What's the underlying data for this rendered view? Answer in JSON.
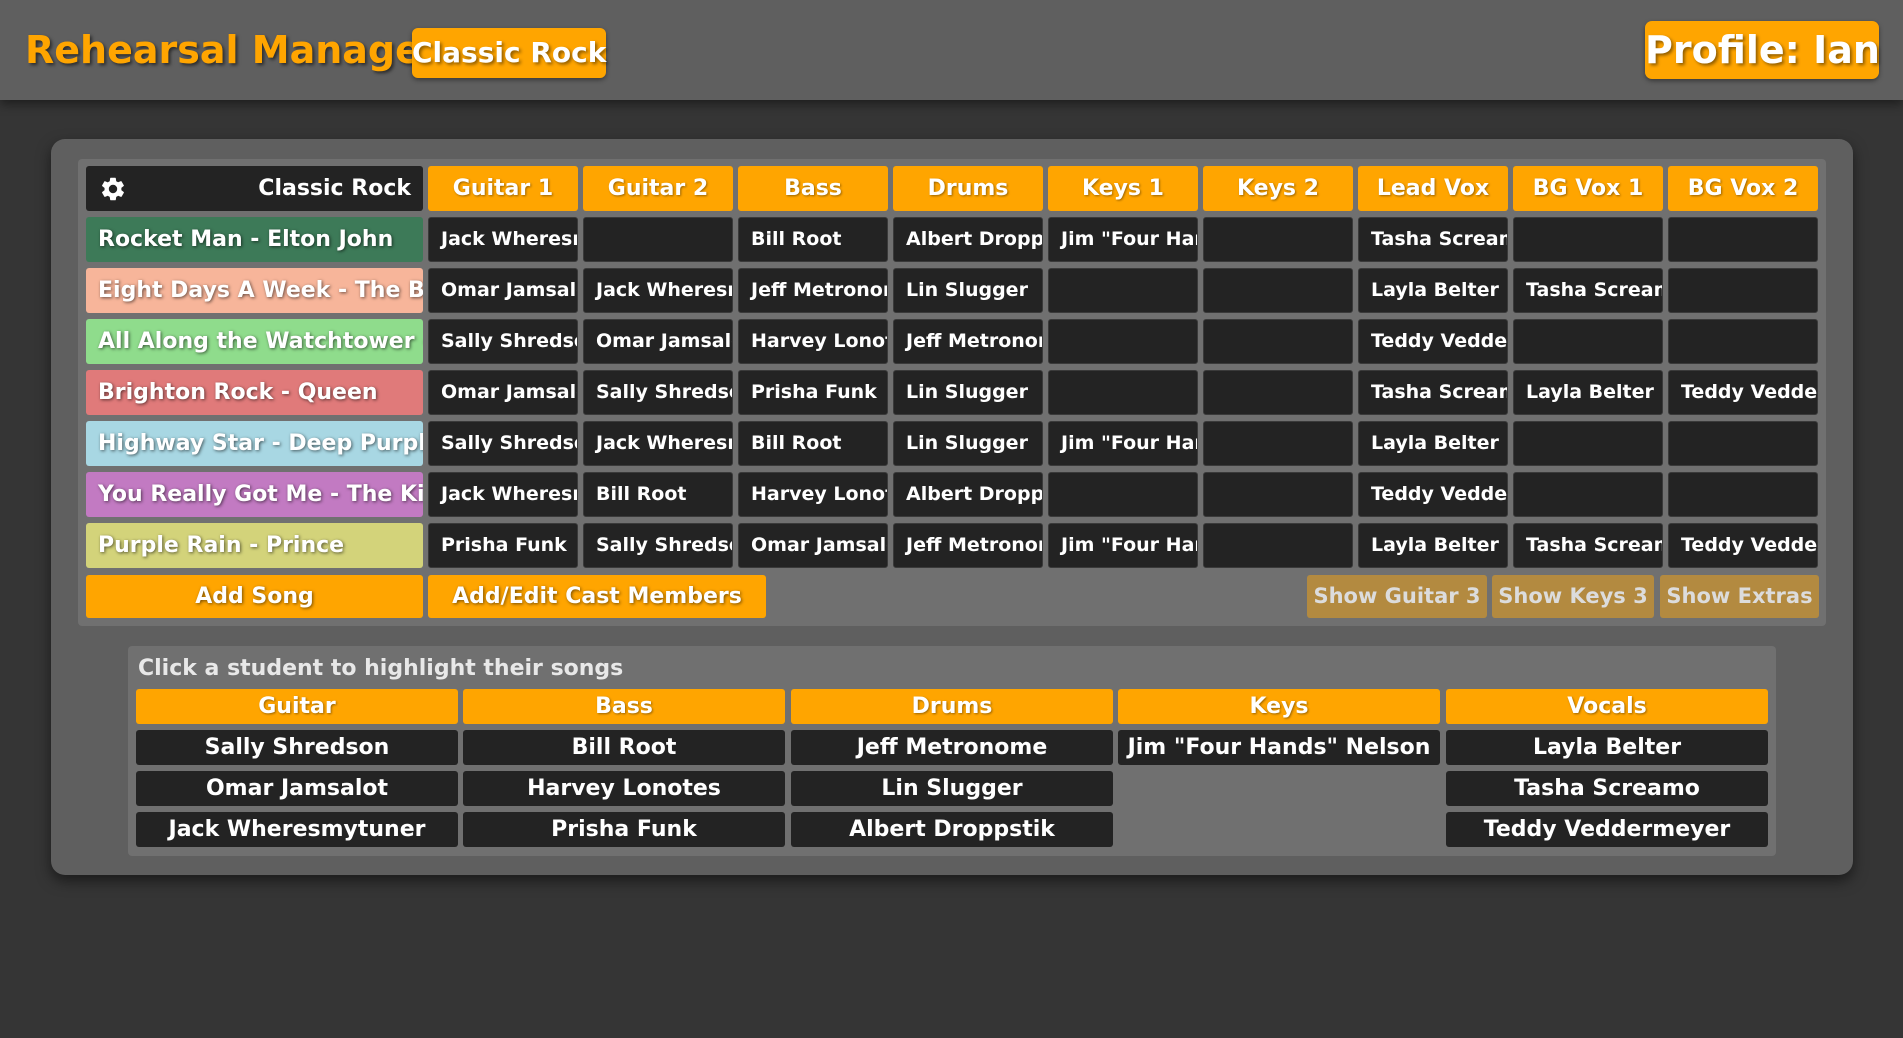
{
  "header": {
    "app_title": "Rehearsal Manager",
    "band_button": "Classic Rock",
    "profile_button": "Profile: Ian"
  },
  "grid": {
    "corner_label": "Classic Rock",
    "settings_icon": "gear-icon",
    "columns": [
      "Guitar 1",
      "Guitar 2",
      "Bass",
      "Drums",
      "Keys 1",
      "Keys 2",
      "Lead Vox",
      "BG Vox 1",
      "BG Vox 2"
    ],
    "songs": [
      {
        "title": "Rocket Man - Elton John",
        "color": "#3d7a58",
        "cast": [
          "Jack Wheresmytuner",
          "",
          "Bill Root",
          "Albert Droppstik",
          "Jim \"Four Hands\" Nelson",
          "",
          "Tasha Screamo",
          "",
          ""
        ]
      },
      {
        "title": "Eight Days A Week - The Beatles",
        "color": "#f7b59a",
        "cast": [
          "Omar Jamsalot",
          "Jack Wheresmytuner",
          "Jeff Metronome",
          "Lin Slugger",
          "",
          "",
          "Layla Belter",
          "Tasha Screamo",
          ""
        ]
      },
      {
        "title": "All Along the Watchtower - Jimi Hendrix",
        "color": "#8fdc8c",
        "cast": [
          "Sally Shredson",
          "Omar Jamsalot",
          "Harvey Lonotes",
          "Jeff Metronome",
          "",
          "",
          "Teddy Veddermeyer",
          "",
          ""
        ]
      },
      {
        "title": "Brighton Rock - Queen",
        "color": "#e07a7a",
        "cast": [
          "Omar Jamsalot",
          "Sally Shredson",
          "Prisha Funk",
          "Lin Slugger",
          "",
          "",
          "Tasha Screamo",
          "Layla Belter",
          "Teddy Veddermeyer"
        ]
      },
      {
        "title": "Highway Star - Deep Purple",
        "color": "#a8d7e3",
        "cast": [
          "Sally Shredson",
          "Jack Wheresmytuner",
          "Bill Root",
          "Lin Slugger",
          "Jim \"Four Hands\" Nelson",
          "",
          "Layla Belter",
          "",
          ""
        ]
      },
      {
        "title": "You Really Got Me - The Kinks",
        "color": "#c27ac2",
        "cast": [
          "Jack Wheresmytuner",
          "Bill Root",
          "Harvey Lonotes",
          "Albert Droppstik",
          "",
          "",
          "Teddy Veddermeyer",
          "",
          ""
        ]
      },
      {
        "title": "Purple Rain - Prince",
        "color": "#d3d37a",
        "cast": [
          "Prisha Funk",
          "Sally Shredson",
          "Omar Jamsalot",
          "Jeff Metronome",
          "Jim \"Four Hands\" Nelson",
          "",
          "Layla Belter",
          "Tasha Screamo",
          "Teddy Veddermeyer"
        ]
      }
    ],
    "add_song": "Add Song",
    "edit_cast": "Add/Edit Cast Members",
    "toggles": [
      "Show Guitar 3",
      "Show Keys 3",
      "Show Extras"
    ]
  },
  "roster": {
    "hint": "Click a student to highlight their songs",
    "groups": [
      {
        "name": "Guitar",
        "members": [
          "Sally Shredson",
          "Omar Jamsalot",
          "Jack Wheresmytuner"
        ]
      },
      {
        "name": "Bass",
        "members": [
          "Bill Root",
          "Harvey Lonotes",
          "Prisha Funk"
        ]
      },
      {
        "name": "Drums",
        "members": [
          "Jeff Metronome",
          "Lin Slugger",
          "Albert Droppstik"
        ]
      },
      {
        "name": "Keys",
        "members": [
          "Jim \"Four Hands\" Nelson"
        ]
      },
      {
        "name": "Vocals",
        "members": [
          "Layla Belter",
          "Tasha Screamo",
          "Teddy Veddermeyer"
        ]
      }
    ]
  },
  "colors": {
    "accent": "#ffa500",
    "toggle_inactive": "#b38a40",
    "cell_dark": "#232323"
  }
}
